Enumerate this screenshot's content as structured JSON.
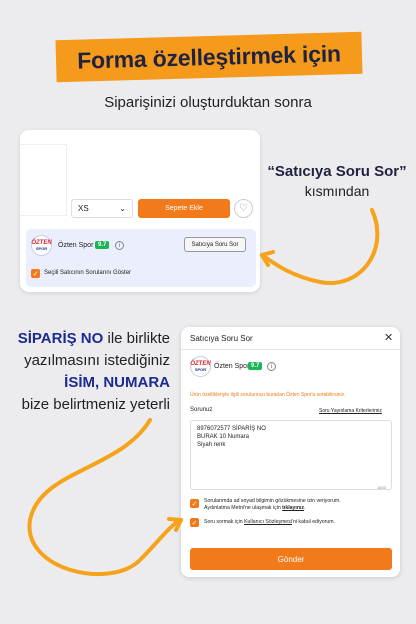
{
  "banner": {
    "title": "Forma özelleştirmek için"
  },
  "subtitle": "Siparişinizi oluşturduktan sonra",
  "card1": {
    "size_value": "XS",
    "add_to_cart": "Sepete Ekle",
    "seller": {
      "name": "Özten Spor",
      "score": "9.7",
      "logo_top": "ÖZTEN",
      "logo_bottom": "SPOR"
    },
    "ask_button": "Satıcıya Soru Sor",
    "checkbox_label": "Seçili Satıcının Sorularını Göster"
  },
  "callout": {
    "title": "“Satıcıya Soru Sor”",
    "subtitle": "kısmından"
  },
  "left_text": {
    "line1_bold": "SİPARİŞ NO",
    "line1_rest": " ile birlikte",
    "line2": "yazılmasını istediğiniz",
    "line3_bold": "İSİM, NUMARA",
    "line4": "bize belirtmeniz yeterli"
  },
  "card2": {
    "title": "Satıcıya Soru Sor",
    "seller": {
      "name": "Özten Spor",
      "score": "9.7"
    },
    "info_text": "Ürün özellikleriyle ilgili sorularınızı buradan Özten Spor'a sorabilirsiniz.",
    "question_label": "Sorunuz",
    "criteria_link": "Soru Yayınlama Kriterlerimiz",
    "question_lines": [
      "8976072577 SİPARİŞ NO",
      "BURAK 10 Numara",
      "Siyah renk"
    ],
    "char_counter": "1603",
    "consent1_line1": "Sorularımda ad soyad bilgimin gözükmesine izin veriyorum.",
    "consent1_prefix": "Aydınlatma Metni'ne ulaşmak için ",
    "consent1_link": "tıklayınız",
    "consent1_suffix": ".",
    "consent2_prefix": "Soru sormak için ",
    "consent2_link": "Kullanıcı Sözleşmesi",
    "consent2_suffix": "'ni kabul ediyorum.",
    "send_button": "Gönder"
  },
  "colors": {
    "accent": "#f27a1a",
    "banner": "#f59a1b",
    "navy": "#1d2b8f",
    "score_green": "#1db454"
  },
  "icons": [
    "heart-icon",
    "info-icon",
    "close-icon",
    "checkbox-check-icon",
    "chevron-down-icon",
    "arrow-icon"
  ]
}
